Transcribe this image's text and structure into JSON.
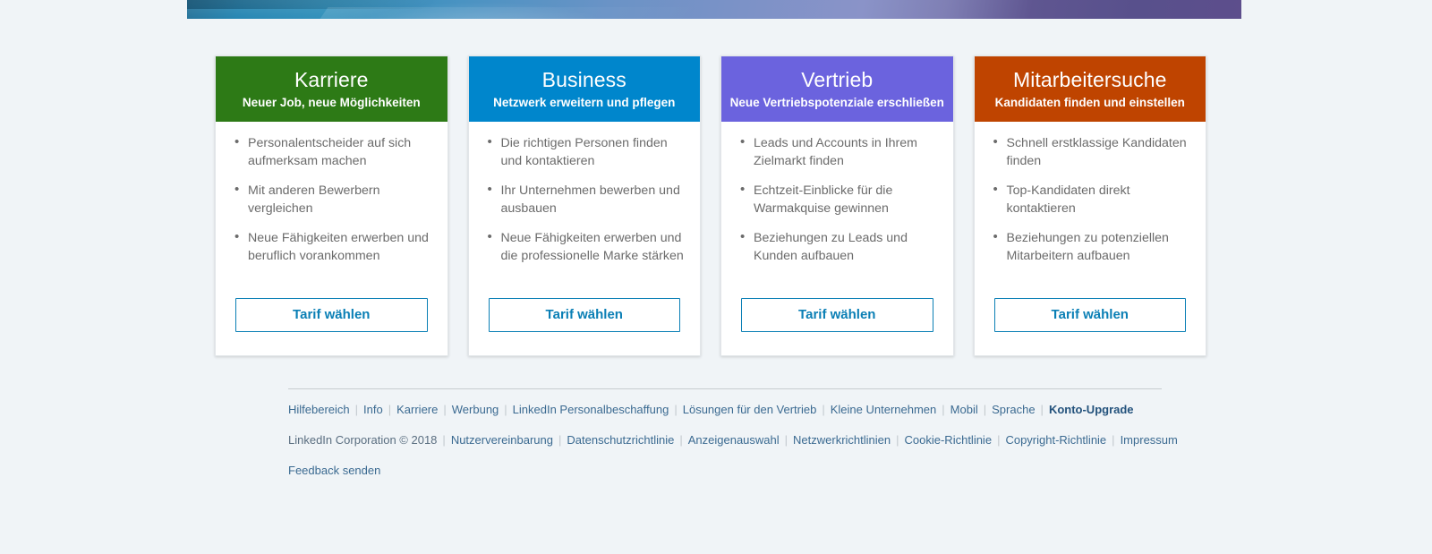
{
  "banner": {
    "name": "hero-banner-gradient",
    "colors": {
      "left": "#1d6d95",
      "middle": "#7b92c7",
      "right": "#5d4e8c"
    }
  },
  "cards": [
    {
      "id": "karriere",
      "title": "Karriere",
      "subtitle": "Neuer Job, neue Möglichkeiten",
      "header_color": "#2d7a16",
      "features": [
        "Personalentscheider auf sich aufmerksam machen",
        "Mit anderen Bewerbern vergleichen",
        "Neue Fähigkeiten erwerben und beruflich vorankommen"
      ],
      "button_label": "Tarif wählen"
    },
    {
      "id": "business",
      "title": "Business",
      "subtitle": "Netzwerk erweitern und pflegen",
      "header_color": "#0086cc",
      "features": [
        "Die richtigen Personen finden und kontaktieren",
        "Ihr Unternehmen bewerben und ausbauen",
        "Neue Fähigkeiten erwerben und die professionelle Marke stärken"
      ],
      "button_label": "Tarif wählen"
    },
    {
      "id": "vertrieb",
      "title": "Vertrieb",
      "subtitle": "Neue Vertriebspotenziale erschließen",
      "header_color": "#6b63de",
      "features": [
        "Leads und Accounts in Ihrem Zielmarkt finden",
        "Echtzeit-Einblicke für die Warmakquise gewinnen",
        "Beziehungen zu Leads und Kunden aufbauen"
      ],
      "button_label": "Tarif wählen"
    },
    {
      "id": "mitarbeitersuche",
      "title": "Mitarbeitersuche",
      "subtitle": "Kandidaten finden und einstellen",
      "header_color": "#bf4400",
      "features": [
        "Schnell erstklassige Kandidaten finden",
        "Top-Kandidaten direkt kontaktieren",
        "Beziehungen zu potenziellen Mitarbeitern aufbauen"
      ],
      "button_label": "Tarif wählen"
    }
  ],
  "footer": {
    "row1": [
      {
        "label": "Hilfebereich",
        "style": "link"
      },
      {
        "label": "Info",
        "style": "link"
      },
      {
        "label": "Karriere",
        "style": "link"
      },
      {
        "label": "Werbung",
        "style": "link"
      },
      {
        "label": "LinkedIn Personalbeschaffung",
        "style": "link"
      },
      {
        "label": "Lösungen für den Vertrieb",
        "style": "link"
      },
      {
        "label": "Kleine Unternehmen",
        "style": "link"
      },
      {
        "label": "Mobil",
        "style": "link"
      },
      {
        "label": "Sprache",
        "style": "link"
      },
      {
        "label": "Konto-Upgrade",
        "style": "bold"
      }
    ],
    "row2": [
      {
        "label": "LinkedIn Corporation © 2018",
        "style": "plain"
      },
      {
        "label": "Nutzervereinbarung",
        "style": "link"
      },
      {
        "label": "Datenschutzrichtlinie",
        "style": "link"
      },
      {
        "label": "Anzeigenauswahl",
        "style": "link"
      },
      {
        "label": "Netzwerkrichtlinien",
        "style": "link"
      },
      {
        "label": "Cookie-Richtlinie",
        "style": "link"
      },
      {
        "label": "Copyright-Richtlinie",
        "style": "link"
      },
      {
        "label": "Impressum",
        "style": "link"
      }
    ],
    "row3": [
      {
        "label": "Feedback senden",
        "style": "link"
      }
    ],
    "separator": "|"
  }
}
